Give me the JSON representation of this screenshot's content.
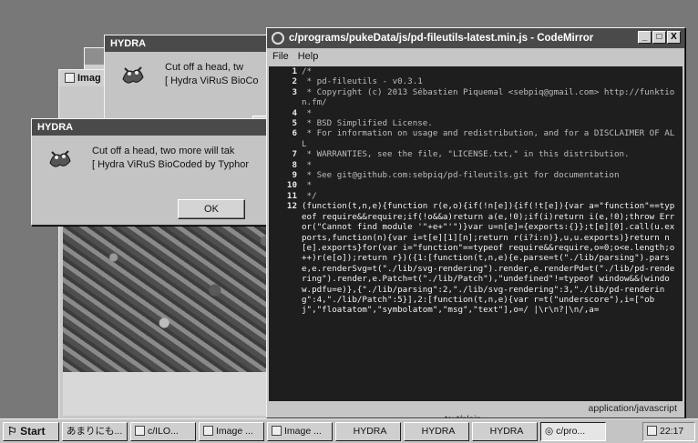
{
  "dialogs": [
    {
      "title": "HYDRA",
      "message_line1": "Cut off a head, tw",
      "message_line2": "[ Hydra ViRuS BioCo"
    },
    {
      "title": "HYDRA",
      "message_line1": "Cut off a head, two more will tak",
      "message_line2": "[ Hydra ViRuS BioCoded by Typhor",
      "ok_label": "OK"
    }
  ],
  "image_window": {
    "title": "Imag"
  },
  "editor": {
    "title": "c/programs/pukeData/js/pd-fileutils-latest.min.js - CodeMirror",
    "menu": [
      "File",
      "Help"
    ],
    "window_buttons": [
      "_",
      "□",
      "X"
    ],
    "lines": [
      {
        "n": "1",
        "t": "/*",
        "comment": true
      },
      {
        "n": "2",
        "t": " * pd-fileutils - v0.3.1",
        "comment": true
      },
      {
        "n": "3",
        "t": " * Copyright (c) 2013 Sébastien Piquemal <sebpiq@gmail.com> http://funktion.fm/",
        "comment": true
      },
      {
        "n": "4",
        "t": " *",
        "comment": true
      },
      {
        "n": "5",
        "t": " * BSD Simplified License.",
        "comment": true
      },
      {
        "n": "6",
        "t": " * For information on usage and redistribution, and for a DISCLAIMER OF ALL",
        "comment": true
      },
      {
        "n": "7",
        "t": " * WARRANTIES, see the file, \"LICENSE.txt,\" in this distribution.",
        "comment": true
      },
      {
        "n": "8",
        "t": " *",
        "comment": true
      },
      {
        "n": "9",
        "t": " * See git@github.com:sebpiq/pd-fileutils.git for documentation",
        "comment": true
      },
      {
        "n": "10",
        "t": " *",
        "comment": true
      },
      {
        "n": "11",
        "t": " */",
        "comment": true
      },
      {
        "n": "12",
        "t": "(function(t,n,e){function r(e,o){if(!n[e]){if(!t[e]){var a=\"function\"==typeof require&&require;if(!o&&a)return a(e,!0);if(i)return i(e,!0);throw Error(\"Cannot find module '\"+e+\"'\")}var u=n[e]={exports:{}};t[e][0].call(u.exports,function(n){var i=t[e][1][n];return r(i?i:n)},u,u.exports)}return n[e].exports}for(var i=\"function\"==typeof require&&require,o=0;o<e.length;o++)r(e[o]);return r})({1:[function(t,n,e){e.parse=t(\"./lib/parsing\").parse,e.renderSvg=t(\"./lib/svg-rendering\").render,e.renderPd=t(\"./lib/pd-rendering\").render,e.Patch=t(\"./lib/Patch\"),\"undefined\"!=typeof window&&(window.pdfu=e)},{\"./lib/parsing\":2,\"./lib/svg-rendering\":3,\"./lib/pd-rendering\":4,\"./lib/Patch\":5}],2:[function(t,n,e){var r=t(\"underscore\"),i=[\"obj\",\"floatatom\",\"symbolatom\",\"msg\",\"text\"],o=/ |\\r\\n?|\\n/,a=",
        "comment": false
      }
    ],
    "mode": "application/javascript"
  },
  "bottom_peek": "text/plain",
  "taskbar": {
    "start": "Start",
    "buttons": [
      {
        "label": "あまりにも..."
      },
      {
        "label": "c/ILO..."
      },
      {
        "label": "Image ..."
      },
      {
        "label": "Image ..."
      },
      {
        "label": "HYDRA"
      },
      {
        "label": "HYDRA"
      },
      {
        "label": "HYDRA"
      },
      {
        "label": "c/pro..."
      }
    ],
    "clock": "22:17"
  }
}
